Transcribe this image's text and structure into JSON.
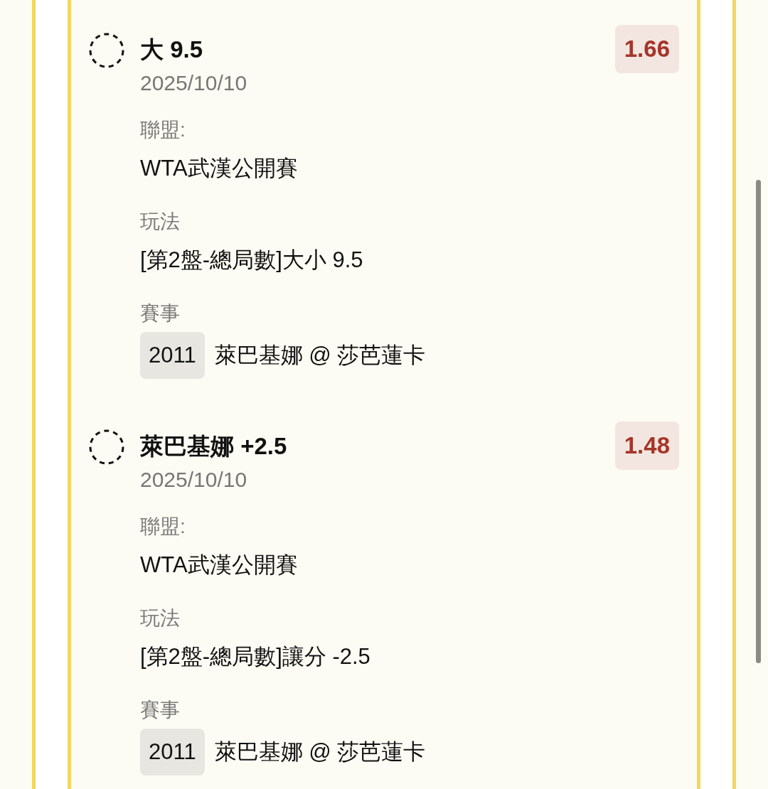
{
  "bets": [
    {
      "settled": false,
      "selection": "大 9.5",
      "odds": "1.66",
      "date": "2025/10/10",
      "fields": [
        {
          "kind": "text",
          "label": "聯盟:",
          "value": "WTA武漢公開賽"
        },
        {
          "kind": "text",
          "label": "玩法",
          "value": "[第2盤-總局數]大小 9.5"
        },
        {
          "kind": "match",
          "label": "賽事",
          "code": "2011",
          "value": "萊巴基娜 @ 莎芭蓮卡"
        }
      ]
    },
    {
      "settled": false,
      "selection": "萊巴基娜 +2.5",
      "odds": "1.48",
      "date": "2025/10/10",
      "fields": [
        {
          "kind": "text",
          "label": "聯盟:",
          "value": "WTA武漢公開賽"
        },
        {
          "kind": "text",
          "label": "玩法",
          "value": "[第2盤-總局數]讓分 -2.5"
        },
        {
          "kind": "match",
          "label": "賽事",
          "code": "2011",
          "value": "萊巴基娜 @ 莎芭蓮卡"
        }
      ]
    }
  ]
}
